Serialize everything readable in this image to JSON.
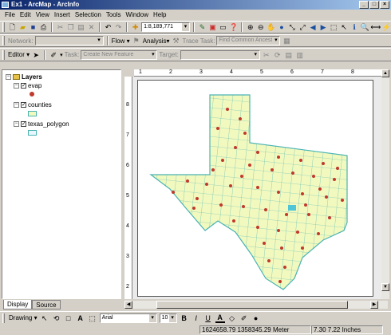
{
  "window": {
    "title": "Ex1 - ArcMap - ArcInfo",
    "btn_min": "_",
    "btn_max": "□",
    "btn_close": "×"
  },
  "menu": [
    "File",
    "Edit",
    "View",
    "Insert",
    "Selection",
    "Tools",
    "Window",
    "Help"
  ],
  "standard_toolbar": {
    "scale": "1:8,189,771"
  },
  "network_toolbar": {
    "network_label": "Network:",
    "flow_label": "Flow ▾",
    "analysis_label": "Analysis▾",
    "trace_task_label": "Trace Task:",
    "trace_task_value": "Find Common Ancesto"
  },
  "editor_toolbar": {
    "editor_label": "Editor ▾",
    "task_label": "Task:",
    "task_value": "Create New Feature",
    "target_label": "Target:"
  },
  "toc": {
    "root": "Layers",
    "layers": [
      {
        "name": "evap",
        "checked": true
      },
      {
        "name": "counties",
        "checked": true
      },
      {
        "name": "texas_polygon",
        "checked": true
      }
    ],
    "tabs": [
      "Display",
      "Source"
    ]
  },
  "ruler_top": [
    "1",
    "2",
    "3",
    "4",
    "5",
    "6",
    "7",
    "8"
  ],
  "ruler_left": [
    "8",
    "7",
    "6",
    "5",
    "4",
    "3",
    "2"
  ],
  "map": {
    "fill_color": "#f2f9bf",
    "line_color": "#4ab3b3",
    "point_color": "#c0392b",
    "lake_color": "#4ec6d8"
  },
  "drawing_toolbar": {
    "drawing_label": "Drawing ▾",
    "font": "Arial",
    "font_size": "10",
    "bold": "B",
    "italic": "I",
    "underline": "U"
  },
  "status_bar": {
    "coordinates": "1624658.79  1358345.29 Meter",
    "page_coords": "7.30  7.22 Inches"
  }
}
